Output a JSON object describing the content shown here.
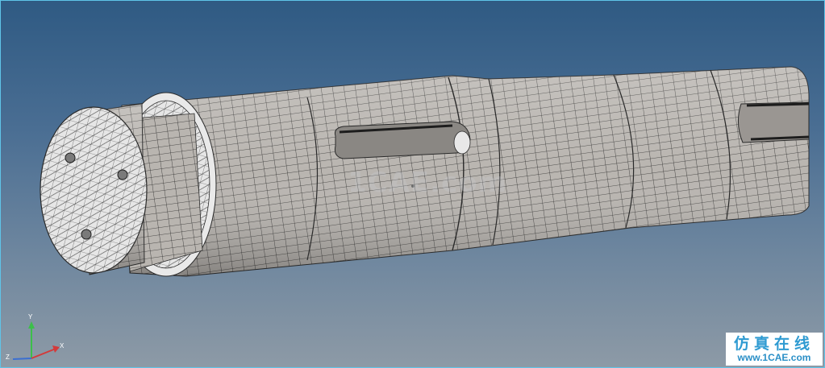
{
  "viewport": {
    "background_top": "#2f5a83",
    "background_bottom": "#8d9aa6",
    "frame_color": "#5fc4e8"
  },
  "model": {
    "mesh_fill": "#b8b4af",
    "end_face_fill": "#e3e3e3",
    "mesh_line_color": "#2a2a2a"
  },
  "watermark": {
    "text": "1CAE.com"
  },
  "axis_triad": {
    "x_label": "X",
    "y_label": "Y",
    "z_label": "Z",
    "x_color": "#d33a3a",
    "y_color": "#3cbf4a",
    "z_color": "#3b6fd1"
  },
  "badge": {
    "title": "仿真在线",
    "url": "www.1CAE.com"
  }
}
